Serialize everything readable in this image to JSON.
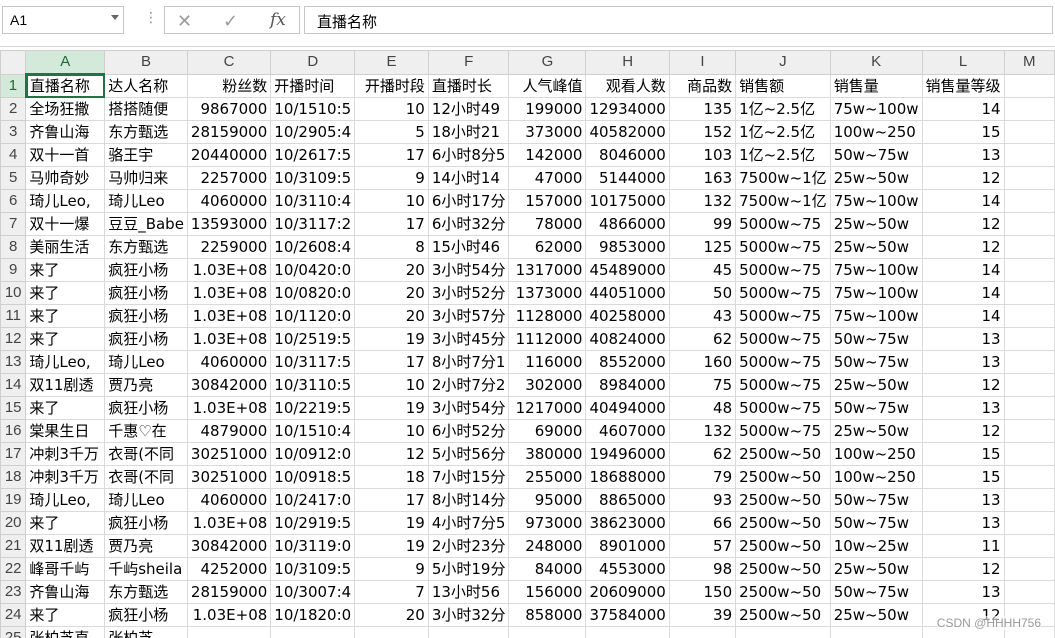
{
  "formula_bar": {
    "name_box": "A1",
    "formula": "直播名称",
    "cancel_icon": "✕",
    "enter_icon": "✓",
    "fx_label": "fx",
    "dots": "⋮"
  },
  "columns": [
    "A",
    "B",
    "C",
    "D",
    "E",
    "F",
    "G",
    "H",
    "I",
    "J",
    "K",
    "L",
    "M"
  ],
  "rows": [
    {
      "n": "1",
      "cells": [
        "直播名称",
        "达人名称",
        "粉丝数",
        "开播时间",
        "开播时段",
        "直播时长",
        "人气峰值",
        "观看人数",
        "商品数",
        "销售额",
        "销售量",
        "销售量等级",
        ""
      ]
    },
    {
      "n": "2",
      "cells": [
        "全场狂撒",
        "搭搭随便",
        "9867000",
        "10/1510:5",
        "10",
        "12小时49",
        "199000",
        "12934000",
        "135",
        "1亿~2.5亿",
        "75w~100w",
        "14",
        ""
      ]
    },
    {
      "n": "3",
      "cells": [
        "齐鲁山海",
        "东方甄选",
        "28159000",
        "10/2905:4",
        "5",
        "18小时21",
        "373000",
        "40582000",
        "152",
        "1亿~2.5亿",
        "100w~250",
        "15",
        ""
      ]
    },
    {
      "n": "4",
      "cells": [
        "双十一首",
        "骆王宇",
        "20440000",
        "10/2617:5",
        "17",
        "6小时8分5",
        "142000",
        "8046000",
        "103",
        "1亿~2.5亿",
        "50w~75w",
        "13",
        ""
      ]
    },
    {
      "n": "5",
      "cells": [
        "马帅奇妙",
        "马帅归来",
        "2257000",
        "10/3109:5",
        "9",
        "14小时14",
        "47000",
        "5144000",
        "163",
        "7500w~1亿",
        "25w~50w",
        "12",
        ""
      ]
    },
    {
      "n": "6",
      "cells": [
        "琦儿Leo,",
        "琦儿Leo",
        "4060000",
        "10/3110:4",
        "10",
        "6小时17分",
        "157000",
        "10175000",
        "132",
        "7500w~1亿",
        "75w~100w",
        "14",
        ""
      ]
    },
    {
      "n": "7",
      "cells": [
        "双十一爆",
        "豆豆_Babe",
        "13593000",
        "10/3117:2",
        "17",
        "6小时32分",
        "78000",
        "4866000",
        "99",
        "5000w~75",
        "25w~50w",
        "12",
        ""
      ]
    },
    {
      "n": "8",
      "cells": [
        "美丽生活",
        "东方甄选",
        "2259000",
        "10/2608:4",
        "8",
        "15小时46",
        "62000",
        "9853000",
        "125",
        "5000w~75",
        "25w~50w",
        "12",
        ""
      ]
    },
    {
      "n": "9",
      "cells": [
        "来了",
        "疯狂小杨",
        "1.03E+08",
        "10/0420:0",
        "20",
        "3小时54分",
        "1317000",
        "45489000",
        "45",
        "5000w~75",
        "75w~100w",
        "14",
        ""
      ]
    },
    {
      "n": "10",
      "cells": [
        "来了",
        "疯狂小杨",
        "1.03E+08",
        "10/0820:0",
        "20",
        "3小时52分",
        "1373000",
        "44051000",
        "50",
        "5000w~75",
        "75w~100w",
        "14",
        ""
      ]
    },
    {
      "n": "11",
      "cells": [
        "来了",
        "疯狂小杨",
        "1.03E+08",
        "10/1120:0",
        "20",
        "3小时57分",
        "1128000",
        "40258000",
        "43",
        "5000w~75",
        "75w~100w",
        "14",
        ""
      ]
    },
    {
      "n": "12",
      "cells": [
        "来了",
        "疯狂小杨",
        "1.03E+08",
        "10/2519:5",
        "19",
        "3小时45分",
        "1112000",
        "40824000",
        "62",
        "5000w~75",
        "50w~75w",
        "13",
        ""
      ]
    },
    {
      "n": "13",
      "cells": [
        "琦儿Leo,",
        "琦儿Leo",
        "4060000",
        "10/3117:5",
        "17",
        "8小时7分1",
        "116000",
        "8552000",
        "160",
        "5000w~75",
        "50w~75w",
        "13",
        ""
      ]
    },
    {
      "n": "14",
      "cells": [
        "双11剧透",
        "贾乃亮",
        "30842000",
        "10/3110:5",
        "10",
        "2小时7分2",
        "302000",
        "8984000",
        "75",
        "5000w~75",
        "25w~50w",
        "12",
        ""
      ]
    },
    {
      "n": "15",
      "cells": [
        "来了",
        "疯狂小杨",
        "1.03E+08",
        "10/2219:5",
        "19",
        "3小时54分",
        "1217000",
        "40494000",
        "48",
        "5000w~75",
        "50w~75w",
        "13",
        ""
      ]
    },
    {
      "n": "16",
      "cells": [
        "棠果生日",
        "千惠♡在",
        "4879000",
        "10/1510:4",
        "10",
        "6小时52分",
        "69000",
        "4607000",
        "132",
        "5000w~75",
        "25w~50w",
        "12",
        ""
      ]
    },
    {
      "n": "17",
      "cells": [
        "冲刺3千万",
        "衣哥(不同",
        "30251000",
        "10/0912:0",
        "12",
        "5小时56分",
        "380000",
        "19496000",
        "62",
        "2500w~50",
        "100w~250",
        "15",
        ""
      ]
    },
    {
      "n": "18",
      "cells": [
        "冲刺3千万",
        "衣哥(不同",
        "30251000",
        "10/0918:5",
        "18",
        "7小时15分",
        "255000",
        "18688000",
        "79",
        "2500w~50",
        "100w~250",
        "15",
        ""
      ]
    },
    {
      "n": "19",
      "cells": [
        "琦儿Leo,",
        "琦儿Leo",
        "4060000",
        "10/2417:0",
        "17",
        "8小时14分",
        "95000",
        "8865000",
        "93",
        "2500w~50",
        "50w~75w",
        "13",
        ""
      ]
    },
    {
      "n": "20",
      "cells": [
        "来了",
        "疯狂小杨",
        "1.03E+08",
        "10/2919:5",
        "19",
        "4小时7分5",
        "973000",
        "38623000",
        "66",
        "2500w~50",
        "50w~75w",
        "13",
        ""
      ]
    },
    {
      "n": "21",
      "cells": [
        "双11剧透",
        "贾乃亮",
        "30842000",
        "10/3119:0",
        "19",
        "2小时23分",
        "248000",
        "8901000",
        "57",
        "2500w~50",
        "10w~25w",
        "11",
        ""
      ]
    },
    {
      "n": "22",
      "cells": [
        "峰哥千屿",
        "千屿sheila",
        "4252000",
        "10/3109:5",
        "9",
        "5小时19分",
        "84000",
        "4553000",
        "98",
        "2500w~50",
        "25w~50w",
        "12",
        ""
      ]
    },
    {
      "n": "23",
      "cells": [
        "齐鲁山海",
        "东方甄选",
        "28159000",
        "10/3007:4",
        "7",
        "13小时56",
        "156000",
        "20609000",
        "150",
        "2500w~50",
        "50w~75w",
        "13",
        ""
      ]
    },
    {
      "n": "24",
      "cells": [
        "来了",
        "疯狂小杨",
        "1.03E+08",
        "10/1820:0",
        "20",
        "3小时32分",
        "858000",
        "37584000",
        "39",
        "2500w~50",
        "25w~50w",
        "12",
        ""
      ]
    },
    {
      "n": "25",
      "cells": [
        "张柏芝直",
        "张柏芝",
        "",
        "",
        "",
        "",
        "",
        "",
        "",
        "",
        "",
        "",
        ""
      ]
    }
  ],
  "watermark": "CSDN @HHHH756",
  "colors": {
    "accent": "#217346",
    "header_bg": "#efefef",
    "grid_line": "#dadada"
  }
}
